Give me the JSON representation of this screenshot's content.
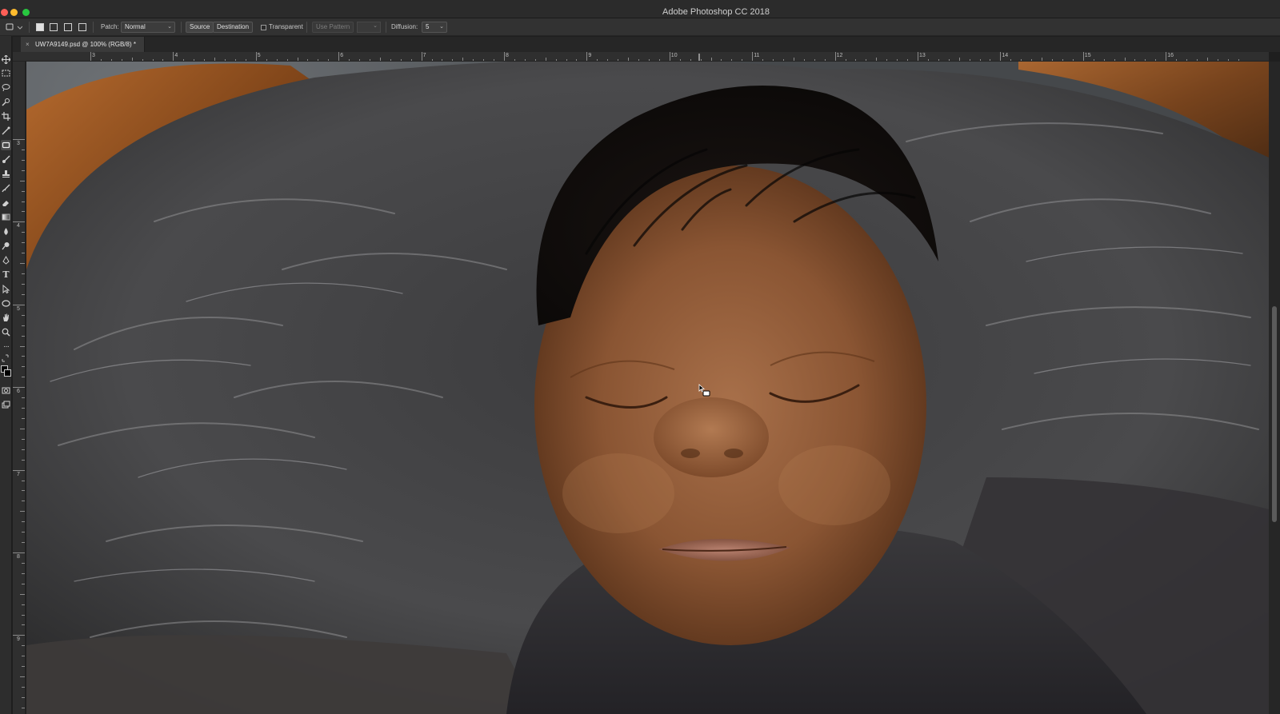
{
  "window": {
    "title": "Adobe Photoshop CC 2018"
  },
  "options_bar": {
    "patch_label": "Patch:",
    "patch_value": "Normal",
    "source_label": "Source",
    "destination_label": "Destination",
    "transparent_label": "Transparent",
    "use_pattern_label": "Use Pattern",
    "diffusion_label": "Diffusion:",
    "diffusion_value": "5"
  },
  "document": {
    "tab_label": "UW7A9149.psd @ 100% (RGB/8) *"
  },
  "rulers": {
    "top": [
      "3",
      "4",
      "5",
      "6",
      "7",
      "8",
      "9",
      "10",
      "11",
      "12",
      "13",
      "14",
      "15",
      "16"
    ],
    "left": [
      "3",
      "4",
      "5",
      "6",
      "7",
      "8",
      "9"
    ]
  },
  "tools": [
    "move-icon",
    "marquee-icon",
    "lasso-icon",
    "quick-select-icon",
    "crop-icon",
    "eyedropper-icon",
    "patch-tool-icon",
    "brush-icon",
    "clone-stamp-icon",
    "history-brush-icon",
    "eraser-icon",
    "gradient-icon",
    "blur-icon",
    "dodge-icon",
    "pen-icon",
    "type-icon",
    "path-select-icon",
    "ellipse-icon",
    "hand-icon",
    "zoom-icon",
    "more-tools-icon",
    "color-swatches",
    "quick-mask-icon",
    "screen-mode-icon"
  ]
}
